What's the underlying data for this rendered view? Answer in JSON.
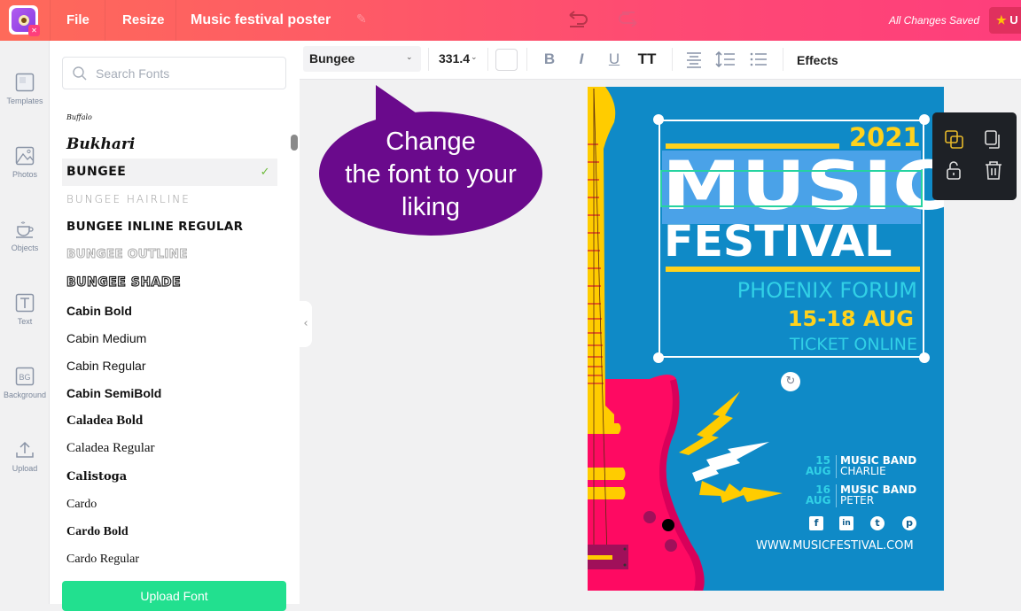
{
  "topbar": {
    "menu": [
      "File",
      "Resize"
    ],
    "document_title": "Music festival poster",
    "status": "All Changes Saved",
    "upgrade_label": "U",
    "colors": {
      "gradient_start": "#fe6a5a",
      "gradient_end": "#fe3e7c"
    }
  },
  "sidebar": {
    "items": [
      {
        "label": "Templates",
        "icon": "template-icon"
      },
      {
        "label": "Photos",
        "icon": "photo-icon"
      },
      {
        "label": "Objects",
        "icon": "cup-icon"
      },
      {
        "label": "Text",
        "icon": "text-icon"
      },
      {
        "label": "Background",
        "icon": "background-icon",
        "glyph": "BG"
      },
      {
        "label": "Upload",
        "icon": "upload-icon"
      }
    ]
  },
  "font_panel": {
    "search_placeholder": "Search Fonts",
    "search_value": "",
    "fonts": [
      {
        "name": "Buffalo",
        "selected": false
      },
      {
        "name": "Bukhari",
        "selected": false
      },
      {
        "name": "BUNGEE",
        "selected": true
      },
      {
        "name": "BUNGEE HAIRLINE",
        "selected": false
      },
      {
        "name": "BUNGEE INLINE REGULAR",
        "selected": false
      },
      {
        "name": "BUNGEE OUTLINE",
        "selected": false
      },
      {
        "name": "BUNGEE SHADE",
        "selected": false
      },
      {
        "name": "Cabin Bold",
        "selected": false
      },
      {
        "name": "Cabin Medium",
        "selected": false
      },
      {
        "name": "Cabin Regular",
        "selected": false
      },
      {
        "name": "Cabin SemiBold",
        "selected": false
      },
      {
        "name": "Caladea Bold",
        "selected": false
      },
      {
        "name": "Caladea Regular",
        "selected": false
      },
      {
        "name": "Calistoga",
        "selected": false
      },
      {
        "name": "Cardo",
        "selected": false
      },
      {
        "name": "Cardo Bold",
        "selected": false
      },
      {
        "name": "Cardo Regular",
        "selected": false
      }
    ],
    "check_glyph": "✓",
    "upload_button": "Upload Font",
    "accent_color": "#22e08f"
  },
  "toolbar": {
    "font_family": "Bungee",
    "font_size": "331.4",
    "text_color": "#ffffff",
    "bold": "B",
    "italic": "I",
    "underline": "U",
    "uppercase": "TT",
    "effects": "Effects"
  },
  "callout": {
    "lines": [
      "Change",
      "the font to your",
      "liking"
    ],
    "color": "#6a0a8c"
  },
  "poster": {
    "year": "2021",
    "title_line1": "MUSIC",
    "title_line2": "FESTIVAL",
    "venue": "PHOENIX FORUM",
    "dates": "15-18 AUG",
    "ticket": "TICKET ONLINE",
    "bands": [
      {
        "day": "15",
        "month": "AUG",
        "title": "MUSIC BAND",
        "name": "CHARLIE"
      },
      {
        "day": "16",
        "month": "AUG",
        "title": "MUSIC BAND",
        "name": "PETER"
      }
    ],
    "socials": [
      {
        "icon": "facebook-icon",
        "glyph": "f"
      },
      {
        "icon": "linkedin-icon",
        "glyph": "in"
      },
      {
        "icon": "twitter-icon",
        "glyph": "t"
      },
      {
        "icon": "pinterest-icon",
        "glyph": "p"
      }
    ],
    "website": "WWW.MUSICFESTIVAL.COM",
    "colors": {
      "background": "#0f8ac7",
      "yellow": "#ffd21c",
      "pink": "#fe0a62",
      "cyan": "#31d0e6"
    }
  },
  "context_menu": {
    "actions": [
      "arrange",
      "duplicate",
      "unlock",
      "delete"
    ]
  }
}
